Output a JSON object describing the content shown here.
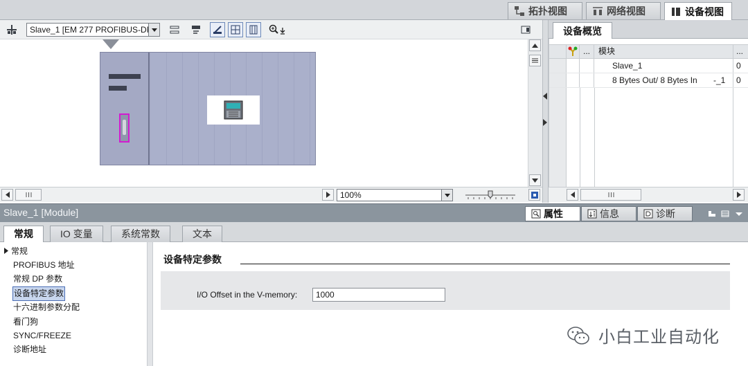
{
  "view_tabs": {
    "topology": "拓扑视图",
    "network": "网络视图",
    "device": "设备视图"
  },
  "toolbar": {
    "device_selector": "Slave_1 [EM 277 PROFIBUS-DP"
  },
  "canvas": {
    "zoom_level": "100%"
  },
  "overview": {
    "tab": "设备概览",
    "header": {
      "dots": "...",
      "module": "模块",
      "more": "..."
    },
    "rows": [
      {
        "module": "Slave_1",
        "num": "0"
      },
      {
        "module": "8 Bytes Out/ 8 Bytes In",
        "suffix": "-_1",
        "num": "0"
      }
    ]
  },
  "inspector": {
    "title": "Slave_1 [Module]",
    "tabs": {
      "properties": "属性",
      "info": "信息",
      "diagnostics": "诊断"
    },
    "subtabs": [
      "常规",
      "IO 变量",
      "系统常数",
      "文本"
    ],
    "nav": {
      "root": "常规",
      "items": [
        "PROFIBUS 地址",
        "常规 DP 参数",
        "设备特定参数",
        "十六进制参数分配",
        "看门狗",
        "SYNC/FREEZE",
        "诊断地址"
      ]
    },
    "section_title": "设备特定参数",
    "param": {
      "label": "I/O Offset in the V-memory:",
      "value": "1000"
    }
  },
  "watermark": "小白工业自动化",
  "colors": {
    "rack": "#a8adc8",
    "port_highlight": "#d21bd0",
    "inspector_title": "#8b959e",
    "selection": "#c8d6ee"
  }
}
